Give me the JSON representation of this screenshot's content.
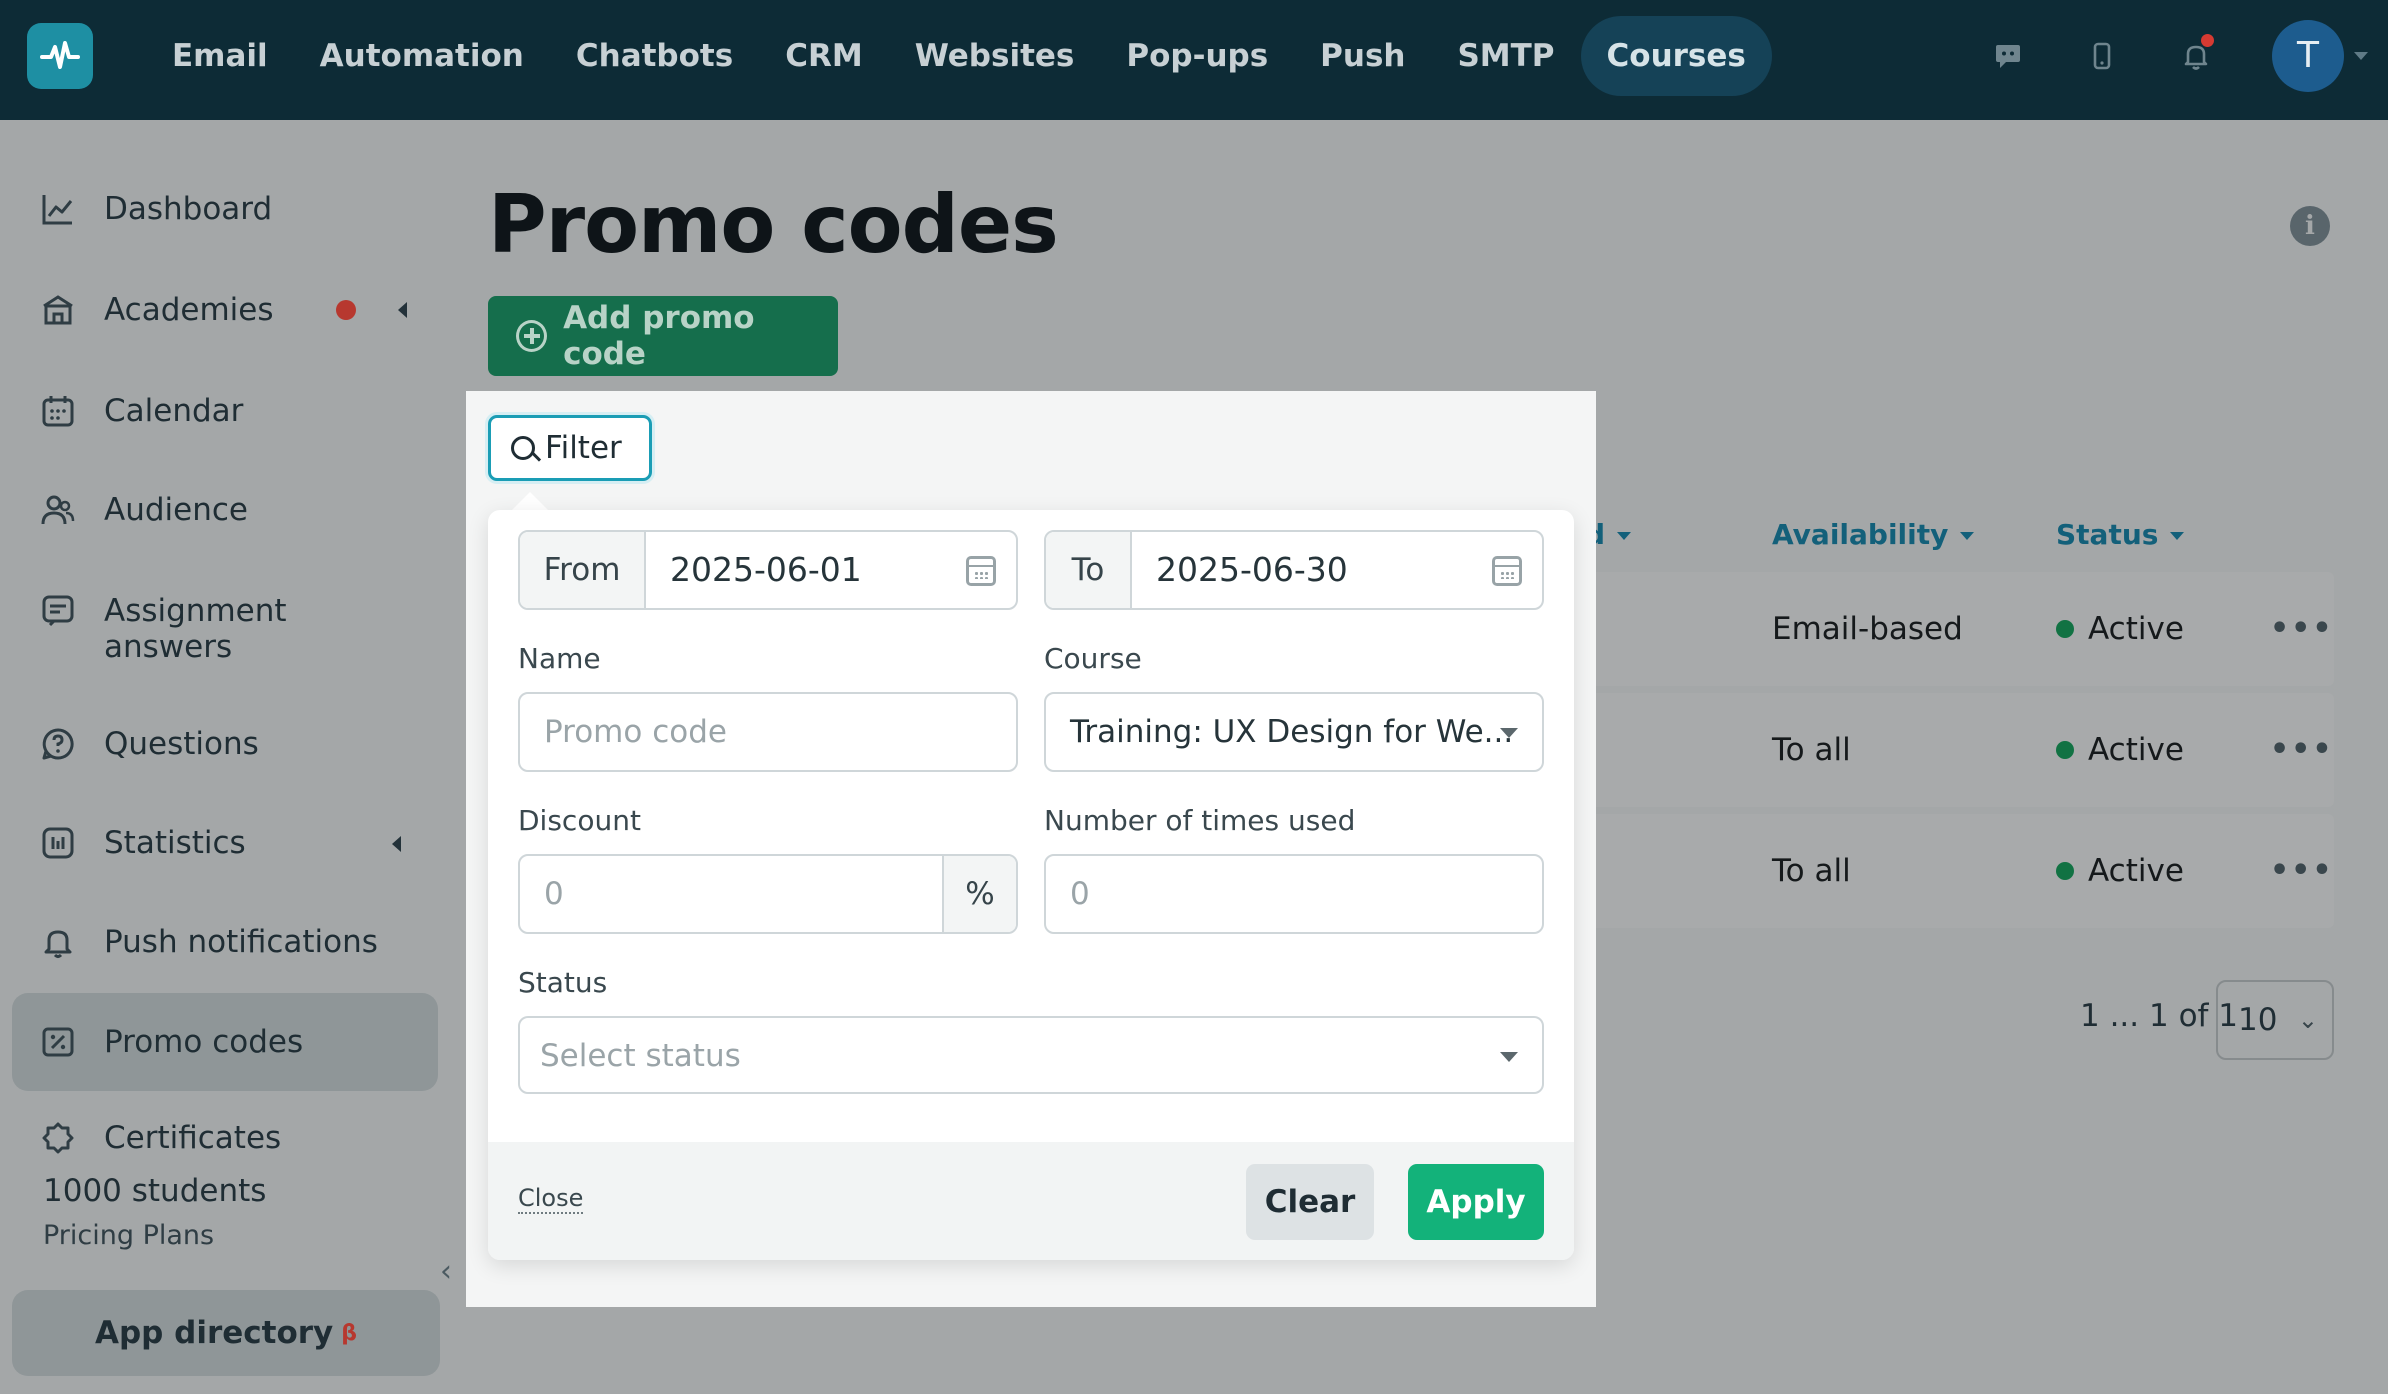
{
  "topnav": {
    "items": [
      {
        "label": "Email",
        "active": false
      },
      {
        "label": "Automation",
        "active": false
      },
      {
        "label": "Chatbots",
        "active": false
      },
      {
        "label": "CRM",
        "active": false
      },
      {
        "label": "Websites",
        "active": false
      },
      {
        "label": "Pop-ups",
        "active": false
      },
      {
        "label": "Push",
        "active": false
      },
      {
        "label": "SMTP",
        "active": false
      },
      {
        "label": "Courses",
        "active": true
      }
    ],
    "icons": [
      "chat-support-icon",
      "mobile-icon",
      "bell-icon"
    ],
    "avatar_initial": "T"
  },
  "sidebar": {
    "items": [
      {
        "label": "Dashboard",
        "icon": "chart-line-icon"
      },
      {
        "label": "Academies",
        "icon": "academy-icon"
      },
      {
        "label": "Calendar",
        "icon": "calendar-icon"
      },
      {
        "label": "Audience",
        "icon": "users-icon"
      },
      {
        "label": "Assignment answers",
        "icon": "assignment-icon"
      },
      {
        "label": "Questions",
        "icon": "question-icon"
      },
      {
        "label": "Statistics",
        "icon": "statistics-icon"
      },
      {
        "label": "Push notifications",
        "icon": "bell-icon"
      },
      {
        "label": "Promo codes",
        "icon": "promo-icon"
      },
      {
        "label": "Certificates",
        "icon": "certificate-icon"
      }
    ],
    "students": "1000 students",
    "pricing": "Pricing Plans",
    "app_directory": "App directory",
    "beta": "β"
  },
  "main": {
    "title": "Promo codes",
    "add_button": "Add promo code",
    "table": {
      "headers": [
        "ed",
        "Availability",
        "Status"
      ],
      "rows": [
        {
          "availability": "Email-based",
          "status": "Active"
        },
        {
          "availability": "To all",
          "status": "Active"
        },
        {
          "availability": "To all",
          "status": "Active"
        }
      ],
      "more": "•••"
    },
    "pagination": "1 ... 1 of 1",
    "per_page": "10"
  },
  "filter": {
    "button": "Filter",
    "from_label": "From",
    "from_value": "2025-06-01",
    "to_label": "To",
    "to_value": "2025-06-30",
    "name_label": "Name",
    "name_placeholder": "Promo code",
    "course_label": "Course",
    "course_value": "Training: UX Design for We...",
    "discount_label": "Discount",
    "discount_placeholder": "0",
    "discount_unit": "%",
    "times_used_label": "Number of times used",
    "times_used_placeholder": "0",
    "status_label": "Status",
    "status_placeholder": "Select status",
    "close": "Close",
    "clear": "Clear",
    "apply": "Apply"
  },
  "colors": {
    "topnav_bg": "#0d2b36",
    "accent_green": "#13b27a",
    "active_status": "#117243"
  }
}
